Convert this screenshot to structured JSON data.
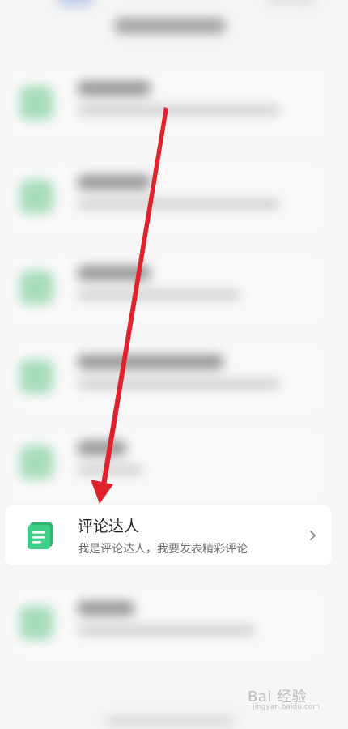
{
  "colors": {
    "accent_green": "#3fcf86",
    "arrow_red": "#e0222d",
    "card_bg": "#ffffff",
    "page_bg": "#f6f6f6"
  },
  "card": {
    "title": "评论达人",
    "subtitle": "我是评论达人，我要发表精彩评论",
    "icon": "comment-icon",
    "chevron_icon": "chevron-right-icon"
  },
  "watermark": {
    "text": "Bai 经验",
    "url": "jingyan.baidu.com"
  }
}
